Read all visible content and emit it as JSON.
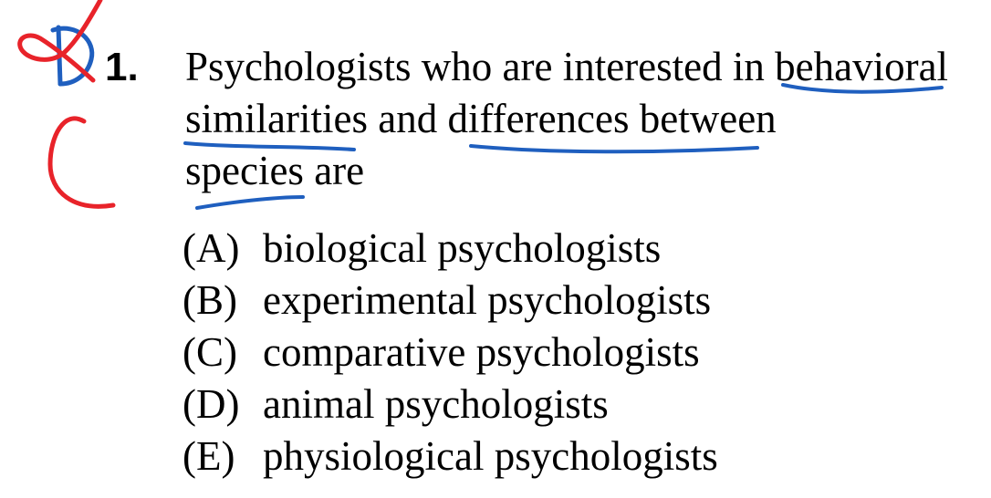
{
  "question": {
    "number": "1.",
    "stem_lines": [
      "Psychologists who are interested in behavioral",
      "similarities and differences between",
      "species are"
    ],
    "options": [
      {
        "letter": "(A)",
        "text": "biological psychologists"
      },
      {
        "letter": "(B)",
        "text": "experimental psychologists"
      },
      {
        "letter": "(C)",
        "text": "comparative psychologists"
      },
      {
        "letter": "(D)",
        "text": "animal psychologists"
      },
      {
        "letter": "(E)",
        "text": "physiological psychologists"
      }
    ]
  },
  "annotations": {
    "wrong_answer_mark": "D",
    "correct_answer_mark": "C",
    "red_ink": "#e8232a",
    "blue_ink": "#1f5fbf"
  }
}
